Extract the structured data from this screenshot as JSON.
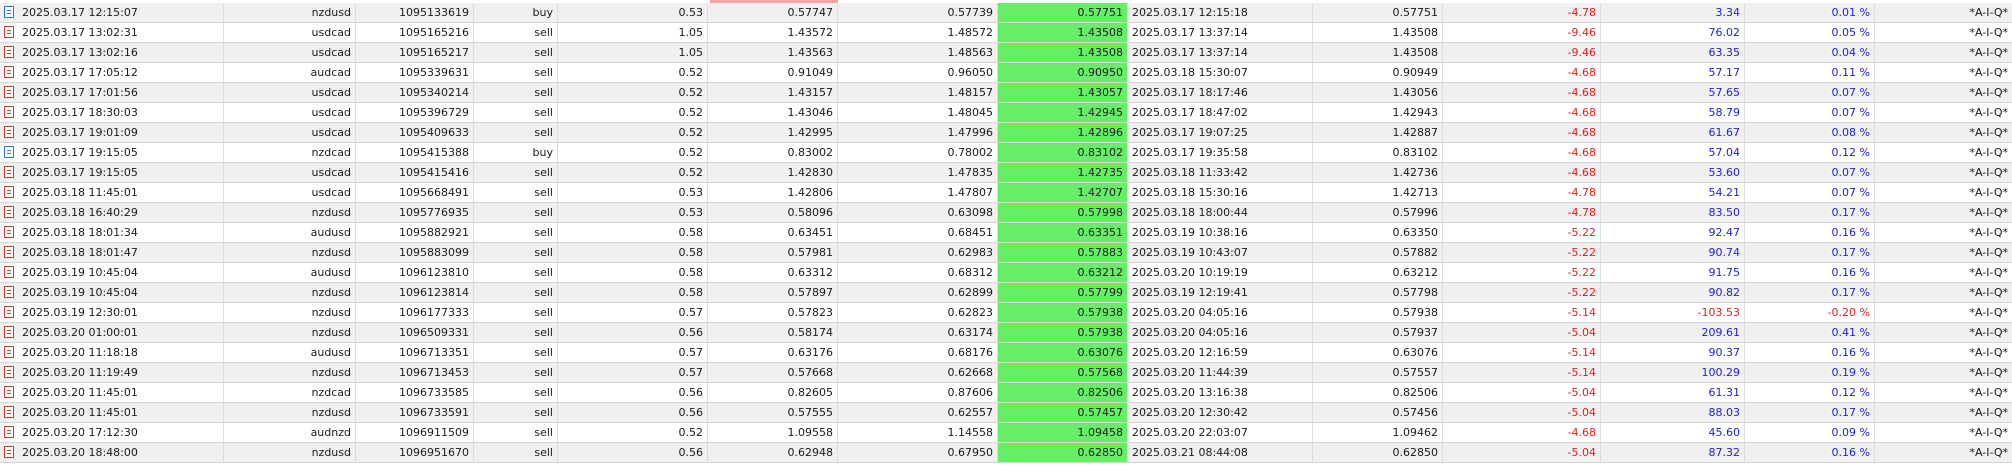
{
  "trades": [
    {
      "open_time": "2025.03.17 12:15:07",
      "symbol": "nzdusd",
      "ticket": "1095133619",
      "type": "buy",
      "volume": "0.53",
      "open_price": "0.57747",
      "sl": "0.57739",
      "tp": "0.57751",
      "close_time": "2025.03.17 12:15:18",
      "close_price": "0.57751",
      "swap": "-4.78",
      "profit": "3.34",
      "percent": "0.01 %",
      "comment": "*A-I-Q*"
    },
    {
      "open_time": "2025.03.17 13:02:31",
      "symbol": "usdcad",
      "ticket": "1095165216",
      "type": "sell",
      "volume": "1.05",
      "open_price": "1.43572",
      "sl": "1.48572",
      "tp": "1.43508",
      "close_time": "2025.03.17 13:37:14",
      "close_price": "1.43508",
      "swap": "-9.46",
      "profit": "76.02",
      "percent": "0.05 %",
      "comment": "*A-I-Q*"
    },
    {
      "open_time": "2025.03.17 13:02:16",
      "symbol": "usdcad",
      "ticket": "1095165217",
      "type": "sell",
      "volume": "1.05",
      "open_price": "1.43563",
      "sl": "1.48563",
      "tp": "1.43508",
      "close_time": "2025.03.17 13:37:14",
      "close_price": "1.43508",
      "swap": "-9.46",
      "profit": "63.35",
      "percent": "0.04 %",
      "comment": "*A-I-Q*"
    },
    {
      "open_time": "2025.03.17 17:05:12",
      "symbol": "audcad",
      "ticket": "1095339631",
      "type": "sell",
      "volume": "0.52",
      "open_price": "0.91049",
      "sl": "0.96050",
      "tp": "0.90950",
      "close_time": "2025.03.18 15:30:07",
      "close_price": "0.90949",
      "swap": "-4.68",
      "profit": "57.17",
      "percent": "0.11 %",
      "comment": "*A-I-Q*"
    },
    {
      "open_time": "2025.03.17 17:01:56",
      "symbol": "usdcad",
      "ticket": "1095340214",
      "type": "sell",
      "volume": "0.52",
      "open_price": "1.43157",
      "sl": "1.48157",
      "tp": "1.43057",
      "close_time": "2025.03.17 18:17:46",
      "close_price": "1.43056",
      "swap": "-4.68",
      "profit": "57.65",
      "percent": "0.07 %",
      "comment": "*A-I-Q*"
    },
    {
      "open_time": "2025.03.17 18:30:03",
      "symbol": "usdcad",
      "ticket": "1095396729",
      "type": "sell",
      "volume": "0.52",
      "open_price": "1.43046",
      "sl": "1.48045",
      "tp": "1.42945",
      "close_time": "2025.03.17 18:47:02",
      "close_price": "1.42943",
      "swap": "-4.68",
      "profit": "58.79",
      "percent": "0.07 %",
      "comment": "*A-I-Q*"
    },
    {
      "open_time": "2025.03.17 19:01:09",
      "symbol": "usdcad",
      "ticket": "1095409633",
      "type": "sell",
      "volume": "0.52",
      "open_price": "1.42995",
      "sl": "1.47996",
      "tp": "1.42896",
      "close_time": "2025.03.17 19:07:25",
      "close_price": "1.42887",
      "swap": "-4.68",
      "profit": "61.67",
      "percent": "0.08 %",
      "comment": "*A-I-Q*"
    },
    {
      "open_time": "2025.03.17 19:15:05",
      "symbol": "nzdcad",
      "ticket": "1095415388",
      "type": "buy",
      "volume": "0.52",
      "open_price": "0.83002",
      "sl": "0.78002",
      "tp": "0.83102",
      "close_time": "2025.03.17 19:35:58",
      "close_price": "0.83102",
      "swap": "-4.68",
      "profit": "57.04",
      "percent": "0.12 %",
      "comment": "*A-I-Q*"
    },
    {
      "open_time": "2025.03.17 19:15:05",
      "symbol": "usdcad",
      "ticket": "1095415416",
      "type": "sell",
      "volume": "0.52",
      "open_price": "1.42830",
      "sl": "1.47835",
      "tp": "1.42735",
      "close_time": "2025.03.18 11:33:42",
      "close_price": "1.42736",
      "swap": "-4.68",
      "profit": "53.60",
      "percent": "0.07 %",
      "comment": "*A-I-Q*"
    },
    {
      "open_time": "2025.03.18 11:45:01",
      "symbol": "usdcad",
      "ticket": "1095668491",
      "type": "sell",
      "volume": "0.53",
      "open_price": "1.42806",
      "sl": "1.47807",
      "tp": "1.42707",
      "close_time": "2025.03.18 15:30:16",
      "close_price": "1.42713",
      "swap": "-4.78",
      "profit": "54.21",
      "percent": "0.07 %",
      "comment": "*A-I-Q*"
    },
    {
      "open_time": "2025.03.18 16:40:29",
      "symbol": "nzdusd",
      "ticket": "1095776935",
      "type": "sell",
      "volume": "0.53",
      "open_price": "0.58096",
      "sl": "0.63098",
      "tp": "0.57998",
      "close_time": "2025.03.18 18:00:44",
      "close_price": "0.57996",
      "swap": "-4.78",
      "profit": "83.50",
      "percent": "0.17 %",
      "comment": "*A-I-Q*"
    },
    {
      "open_time": "2025.03.18 18:01:34",
      "symbol": "audusd",
      "ticket": "1095882921",
      "type": "sell",
      "volume": "0.58",
      "open_price": "0.63451",
      "sl": "0.68451",
      "tp": "0.63351",
      "close_time": "2025.03.19 10:38:16",
      "close_price": "0.63350",
      "swap": "-5.22",
      "profit": "92.47",
      "percent": "0.16 %",
      "comment": "*A-I-Q*"
    },
    {
      "open_time": "2025.03.18 18:01:47",
      "symbol": "nzdusd",
      "ticket": "1095883099",
      "type": "sell",
      "volume": "0.58",
      "open_price": "0.57981",
      "sl": "0.62983",
      "tp": "0.57883",
      "close_time": "2025.03.19 10:43:07",
      "close_price": "0.57882",
      "swap": "-5.22",
      "profit": "90.74",
      "percent": "0.17 %",
      "comment": "*A-I-Q*"
    },
    {
      "open_time": "2025.03.19 10:45:04",
      "symbol": "audusd",
      "ticket": "1096123810",
      "type": "sell",
      "volume": "0.58",
      "open_price": "0.63312",
      "sl": "0.68312",
      "tp": "0.63212",
      "close_time": "2025.03.20 10:19:19",
      "close_price": "0.63212",
      "swap": "-5.22",
      "profit": "91.75",
      "percent": "0.16 %",
      "comment": "*A-I-Q*"
    },
    {
      "open_time": "2025.03.19 10:45:04",
      "symbol": "nzdusd",
      "ticket": "1096123814",
      "type": "sell",
      "volume": "0.58",
      "open_price": "0.57897",
      "sl": "0.62899",
      "tp": "0.57799",
      "close_time": "2025.03.19 12:19:41",
      "close_price": "0.57798",
      "swap": "-5.22",
      "profit": "90.82",
      "percent": "0.17 %",
      "comment": "*A-I-Q*"
    },
    {
      "open_time": "2025.03.19 12:30:01",
      "symbol": "nzdusd",
      "ticket": "1096177333",
      "type": "sell",
      "volume": "0.57",
      "open_price": "0.57823",
      "sl": "0.62823",
      "tp": "0.57938",
      "close_time": "2025.03.20 04:05:16",
      "close_price": "0.57938",
      "swap": "-5.14",
      "profit": "-103.53",
      "percent": "-0.20 %",
      "comment": "*A-I-Q*"
    },
    {
      "open_time": "2025.03.20 01:00:01",
      "symbol": "nzdusd",
      "ticket": "1096509331",
      "type": "sell",
      "volume": "0.56",
      "open_price": "0.58174",
      "sl": "0.63174",
      "tp": "0.57938",
      "close_time": "2025.03.20 04:05:16",
      "close_price": "0.57937",
      "swap": "-5.04",
      "profit": "209.61",
      "percent": "0.41 %",
      "comment": "*A-I-Q*"
    },
    {
      "open_time": "2025.03.20 11:18:18",
      "symbol": "audusd",
      "ticket": "1096713351",
      "type": "sell",
      "volume": "0.57",
      "open_price": "0.63176",
      "sl": "0.68176",
      "tp": "0.63076",
      "close_time": "2025.03.20 12:16:59",
      "close_price": "0.63076",
      "swap": "-5.14",
      "profit": "90.37",
      "percent": "0.16 %",
      "comment": "*A-I-Q*"
    },
    {
      "open_time": "2025.03.20 11:19:49",
      "symbol": "nzdusd",
      "ticket": "1096713453",
      "type": "sell",
      "volume": "0.57",
      "open_price": "0.57668",
      "sl": "0.62668",
      "tp": "0.57568",
      "close_time": "2025.03.20 11:44:39",
      "close_price": "0.57557",
      "swap": "-5.14",
      "profit": "100.29",
      "percent": "0.19 %",
      "comment": "*A-I-Q*"
    },
    {
      "open_time": "2025.03.20 11:45:01",
      "symbol": "nzdcad",
      "ticket": "1096733585",
      "type": "sell",
      "volume": "0.56",
      "open_price": "0.82605",
      "sl": "0.87606",
      "tp": "0.82506",
      "close_time": "2025.03.20 13:16:38",
      "close_price": "0.82506",
      "swap": "-5.04",
      "profit": "61.31",
      "percent": "0.12 %",
      "comment": "*A-I-Q*"
    },
    {
      "open_time": "2025.03.20 11:45:01",
      "symbol": "nzdusd",
      "ticket": "1096733591",
      "type": "sell",
      "volume": "0.56",
      "open_price": "0.57555",
      "sl": "0.62557",
      "tp": "0.57457",
      "close_time": "2025.03.20 12:30:42",
      "close_price": "0.57456",
      "swap": "-5.04",
      "profit": "88.03",
      "percent": "0.17 %",
      "comment": "*A-I-Q*"
    },
    {
      "open_time": "2025.03.20 17:12:30",
      "symbol": "audnzd",
      "ticket": "1096911509",
      "type": "sell",
      "volume": "0.52",
      "open_price": "1.09558",
      "sl": "1.14558",
      "tp": "1.09458",
      "close_time": "2025.03.20 22:03:07",
      "close_price": "1.09462",
      "swap": "-4.68",
      "profit": "45.60",
      "percent": "0.09 %",
      "comment": "*A-I-Q*"
    },
    {
      "open_time": "2025.03.20 18:48:00",
      "symbol": "nzdusd",
      "ticket": "1096951670",
      "type": "sell",
      "volume": "0.56",
      "open_price": "0.62948",
      "sl": "0.67950",
      "tp": "0.62850",
      "close_time": "2025.03.21 08:44:08",
      "close_price": "0.62850",
      "swap": "-5.04",
      "profit": "87.32",
      "percent": "0.16 %",
      "comment": "*A-I-Q*"
    }
  ],
  "colors": {
    "highlight_green": "#66ee66",
    "negative": "#e02020",
    "positive": "#2222cc",
    "row_alt": "#f0f0f0"
  }
}
